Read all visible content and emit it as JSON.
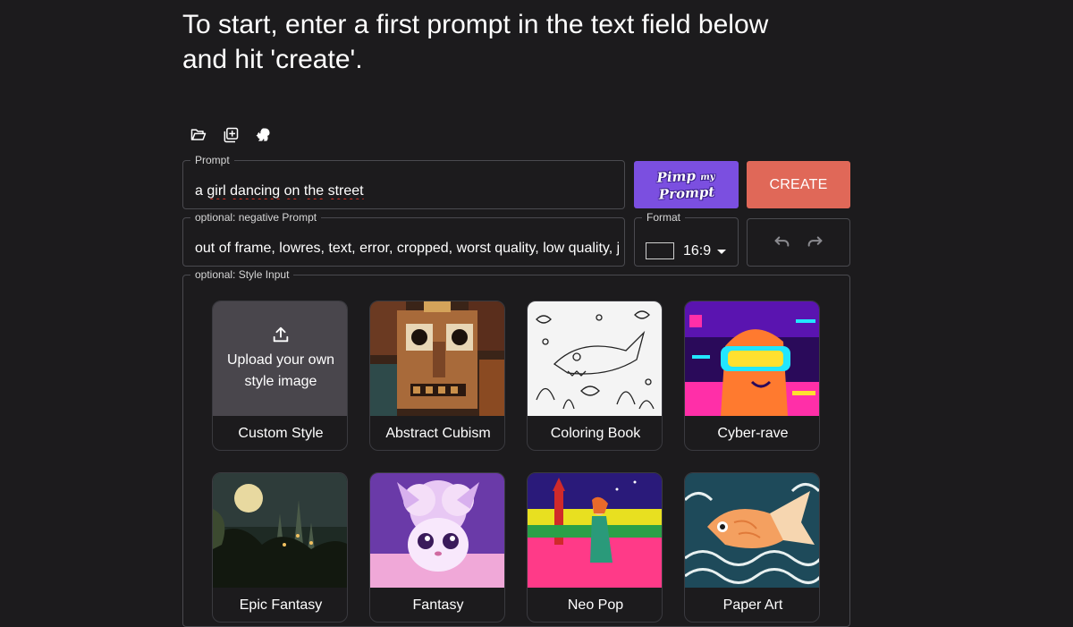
{
  "intro": {
    "line1": "To start, enter a first prompt in the text field below",
    "line2": "and hit 'create'."
  },
  "toolbar": {
    "icons": [
      "folder-open-icon",
      "add-copy-icon",
      "squirrel-icon"
    ]
  },
  "prompt": {
    "legend": "Prompt",
    "value_words": [
      "a",
      "girl",
      "dancing",
      "on",
      "the",
      "street"
    ]
  },
  "negative_prompt": {
    "legend": "optional: negative Prompt",
    "value": "out of frame, lowres, text, error, cropped, worst quality, low quality, jpeg"
  },
  "pimp_button": {
    "line1": "Pimp",
    "my": "my",
    "line2": "Prompt"
  },
  "create_button": {
    "label": "CREATE"
  },
  "format": {
    "legend": "Format",
    "value": "16:9"
  },
  "style_input": {
    "legend": "optional: Style Input",
    "upload_text_1": "Upload your own",
    "upload_text_2": "style image",
    "cards": [
      {
        "label": "Custom Style"
      },
      {
        "label": "Abstract Cubism"
      },
      {
        "label": "Coloring Book"
      },
      {
        "label": "Cyber-rave"
      },
      {
        "label": "Epic Fantasy"
      },
      {
        "label": "Fantasy"
      },
      {
        "label": "Neo Pop"
      },
      {
        "label": "Paper Art"
      }
    ]
  },
  "colors": {
    "background": "#1c1b1d",
    "pimp": "#7b4fe0",
    "create": "#e06858",
    "border": "#4a4a4f"
  }
}
